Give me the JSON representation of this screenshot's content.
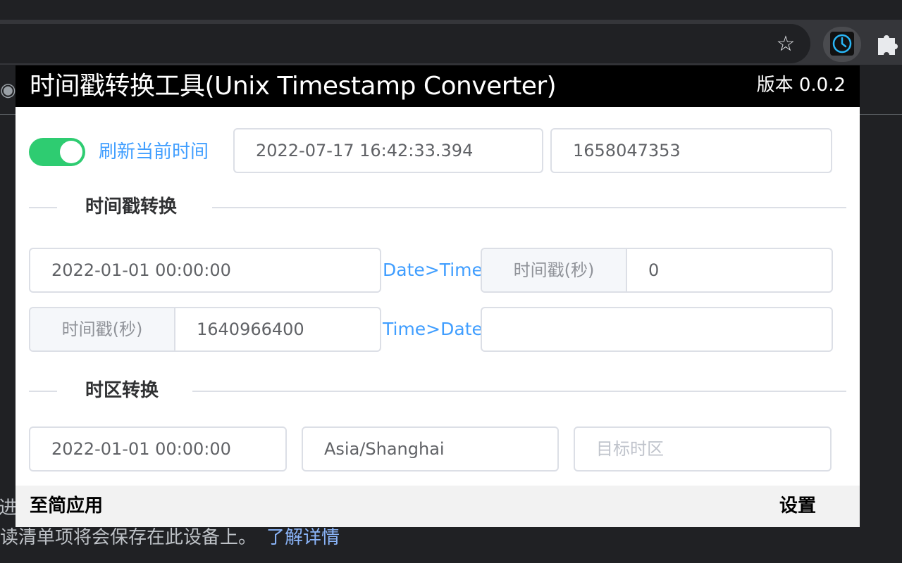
{
  "browser": {
    "star_icon": "star-icon",
    "extension_icon": "clock-icon",
    "puzzle_icon": "puzzle-icon",
    "background_text_1": "进",
    "background_text_2": "读清单项将会保存在此设备上。",
    "background_link": "了解详情"
  },
  "popup": {
    "title": "时间戳转换工具(Unix Timestamp Converter)",
    "version": "版本 0.0.2",
    "refresh": {
      "enabled": true,
      "label": "刷新当前时间",
      "current_datetime": "2022-07-17 16:42:33.394",
      "current_timestamp": "1658047353"
    },
    "timestamp_section": {
      "title": "时间戳转换",
      "date_input": "2022-01-01 00:00:00",
      "date_to_time_label": "Date>Time",
      "result_prepend": "时间戳(秒)",
      "result_value": "0",
      "ts_prepend": "时间戳(秒)",
      "ts_input": "1640966400",
      "time_to_date_label": "Time>Date",
      "date_result": ""
    },
    "timezone_section": {
      "title": "时区转换",
      "datetime_input": "2022-01-01 00:00:00",
      "source_timezone": "Asia/Shanghai",
      "target_placeholder": "目标时区"
    },
    "footer": {
      "left": "至简应用",
      "right": "设置"
    }
  },
  "colors": {
    "accent": "#409eff",
    "toggle_on": "#2ecc71",
    "header_bg": "#000000"
  }
}
